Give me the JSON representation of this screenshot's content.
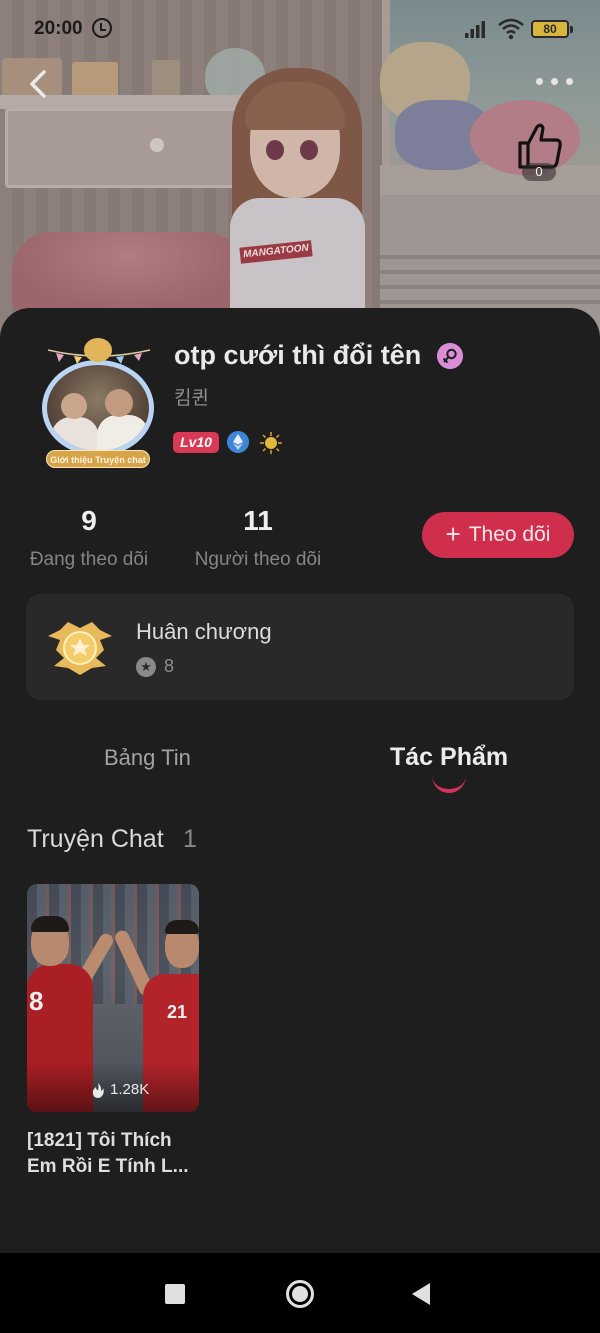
{
  "status_bar": {
    "time": "20:00",
    "battery": "80"
  },
  "banner": {
    "shirt_text": "MANGATOON",
    "like_count": "0"
  },
  "profile": {
    "username": "otp cưới thì đổi tên",
    "alias": "킴퀸",
    "level": "Lv10",
    "avatar_caption": "Giới thiệu Truyện chat"
  },
  "stats": {
    "following_count": "9",
    "following_label": "Đang theo dõi",
    "followers_count": "11",
    "followers_label": "Người theo dõi"
  },
  "follow_button": {
    "plus": "+",
    "label": "Theo dõi"
  },
  "medals": {
    "title": "Huân chương",
    "count": "8"
  },
  "tabs": [
    {
      "label": "Bảng Tin",
      "active": false
    },
    {
      "label": "Tác Phẩm",
      "active": true
    }
  ],
  "section": {
    "title": "Truyện Chat",
    "count": "1"
  },
  "works": [
    {
      "title": "[1821] Tôi Thích Em Rồi E Tính L...",
      "views": "1.28K",
      "jersey_left": "8",
      "jersey_right": "21"
    }
  ],
  "colors": {
    "accent": "#cf2f4c",
    "background": "#1e1e1e",
    "card": "#292929",
    "level_badge": "#d93955"
  },
  "icons": [
    "alarm-icon",
    "signal-icon",
    "wifi-icon",
    "battery-icon",
    "back-arrow-icon",
    "more-dots-icon",
    "thumbs-up-icon",
    "female-icon",
    "ethereum-icon",
    "coin-icon",
    "medal-icon",
    "star-icon",
    "fire-icon",
    "nav-recent-icon",
    "nav-home-icon",
    "nav-back-icon"
  ]
}
